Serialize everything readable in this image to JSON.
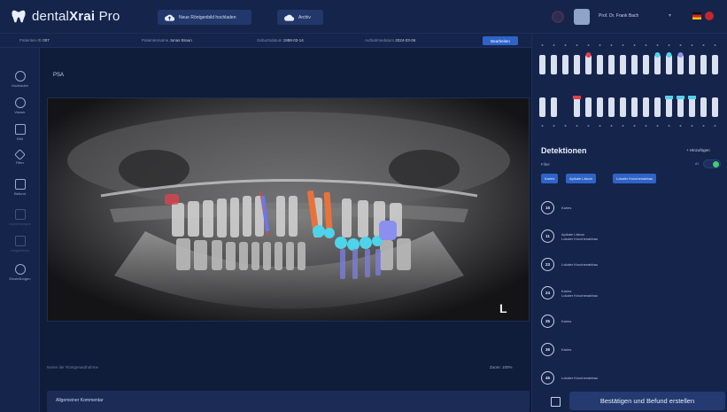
{
  "app": {
    "name_part1": "dental",
    "name_part2": "Xrai",
    "name_part3": " Pro"
  },
  "topbar": {
    "upload_label": "Neue Röntgenbild hochladen",
    "archive_label": "Archiv",
    "user_name": "Prof. Dr. Frank Bach",
    "chevron": "▾"
  },
  "infobar": {
    "patient_label": "Patienten-ID",
    "patient_value": "007",
    "name_label": "Patientenname",
    "name_value": "Jonas Braun",
    "dob_label": "Geburtsdatum",
    "dob_value": "1988-03-14",
    "date_label": "Aufnahmedatum",
    "date_value": "2024-03-06",
    "action_label": "Bearbeiten"
  },
  "sidebar": {
    "items": [
      {
        "label": "Hochladen"
      },
      {
        "label": "Viewer"
      },
      {
        "label": "Bild"
      },
      {
        "label": "Filter"
      },
      {
        "label": "Befund"
      },
      {
        "label": "Anmerkungen"
      },
      {
        "label": "Vergleichen"
      },
      {
        "label": "Einstellungen"
      }
    ]
  },
  "viewer": {
    "title": "PSA",
    "side_marker": "L",
    "footer_note": "Name der Röntgenaufnahme",
    "zoom": "Zoom: 100%",
    "comments_label": "Allgemeiner Kommentar"
  },
  "panel": {
    "detections_title": "Detektionen",
    "add_label": "+ Hinzufügen",
    "filter_label": "Filter",
    "toggle_label": "AI",
    "chips": [
      "Karies",
      "Apikale Läsion",
      "Lokaler Knochenabbau"
    ],
    "detections": [
      {
        "tooth": "16",
        "line1": "Karies",
        "line2": ""
      },
      {
        "tooth": "11",
        "line1": "Apikale Läsion",
        "line2": "Lokaler Knochenabbau"
      },
      {
        "tooth": "23",
        "line1": "Lokaler Knochenabbau",
        "line2": ""
      },
      {
        "tooth": "24",
        "line1": "Karies",
        "line2": "Lokaler Knochenabbau"
      },
      {
        "tooth": "35",
        "line1": "Karies",
        "line2": ""
      },
      {
        "tooth": "36",
        "line1": "Karies",
        "line2": ""
      },
      {
        "tooth": "46",
        "line1": "Lokaler Knochenabbau",
        "line2": ""
      }
    ],
    "confirm_label": "Bestätigen und Befund erstellen"
  },
  "colors": {
    "accent": "#2e63c8",
    "root_filling": "#e8733a",
    "crown": "#4fd3ea",
    "implant": "#8b8ff0",
    "caries": "#e0414e"
  }
}
